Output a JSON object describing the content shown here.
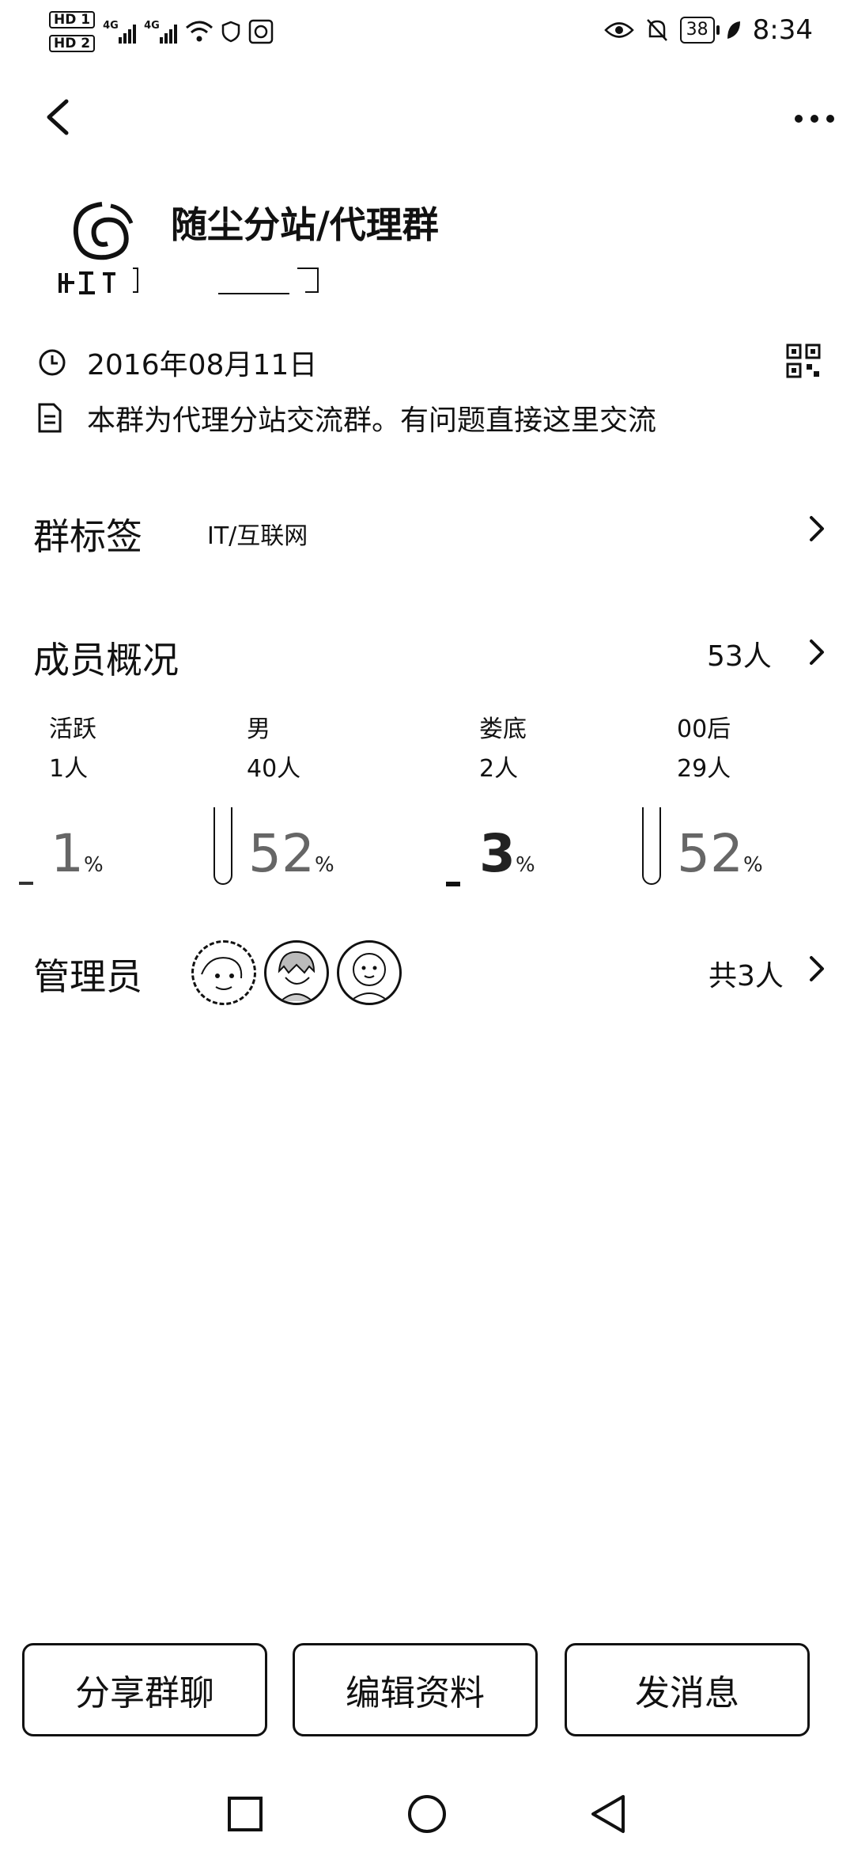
{
  "status_bar": {
    "sim1": "HD 1",
    "sim2": "HD 2",
    "net1": "4G",
    "net2": "4G",
    "battery": "38",
    "time": "8:34"
  },
  "group": {
    "name": "随尘分站/代理群",
    "date": "2016年08月11日",
    "description": "本群为代理分站交流群。有问题直接这里交流"
  },
  "tags": {
    "title": "群标签",
    "value": "IT/互联网"
  },
  "members": {
    "title": "成员概况",
    "count": "53人",
    "stats": [
      {
        "label": "活跃",
        "value": "1人",
        "percent": "1",
        "pct_sign": "%"
      },
      {
        "label": "男",
        "value": "40人",
        "percent": "52",
        "pct_sign": "%"
      },
      {
        "label": "娄底",
        "value": "2人",
        "percent": "3",
        "pct_sign": "%"
      },
      {
        "label": "00后",
        "value": "29人",
        "percent": "52",
        "pct_sign": "%"
      }
    ]
  },
  "admins": {
    "title": "管理员",
    "count": "共3人"
  },
  "actions": {
    "share": "分享群聊",
    "edit": "编辑资料",
    "message": "发消息"
  },
  "icons": [
    "back-icon",
    "more-icon",
    "clock-icon",
    "document-icon",
    "qr-code-icon",
    "chevron-right-icon"
  ]
}
